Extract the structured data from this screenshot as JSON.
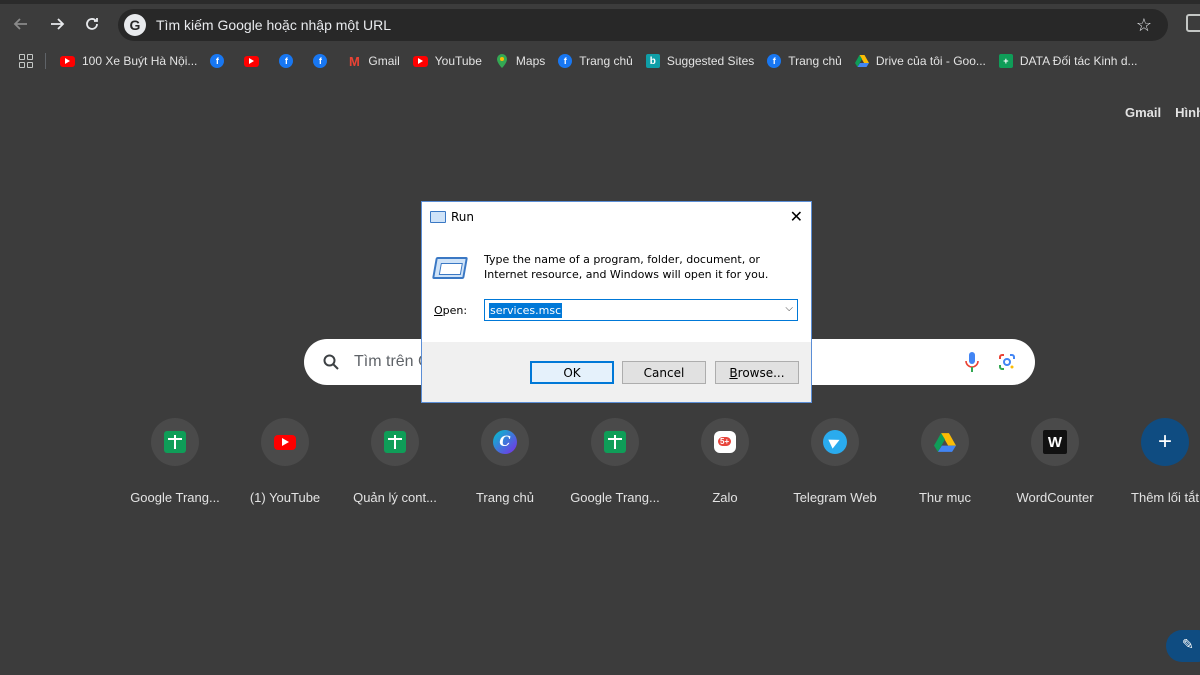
{
  "browser": {
    "omnibox_text": "Tìm kiếm Google hoặc nhập một URL",
    "omnibox_logo": "G"
  },
  "bookmarks": [
    {
      "label": "100 Xe Buýt Hà Nội...",
      "icon": "youtube-icon"
    },
    {
      "label": "",
      "icon": "facebook-icon"
    },
    {
      "label": "",
      "icon": "youtube-icon"
    },
    {
      "label": "",
      "icon": "facebook-icon"
    },
    {
      "label": "",
      "icon": "facebook-icon"
    },
    {
      "label": "Gmail",
      "icon": "gmail-icon"
    },
    {
      "label": "YouTube",
      "icon": "youtube-icon"
    },
    {
      "label": "Maps",
      "icon": "maps-icon"
    },
    {
      "label": "Trang chủ",
      "icon": "facebook-icon"
    },
    {
      "label": "Suggested Sites",
      "icon": "bing-icon"
    },
    {
      "label": "Trang chủ",
      "icon": "facebook-icon"
    },
    {
      "label": "Drive của tôi - Goo...",
      "icon": "drive-icon"
    },
    {
      "label": "DATA Đối tác Kinh d...",
      "icon": "sheets-icon"
    }
  ],
  "top_links": {
    "gmail": "Gmail",
    "images": "Hình"
  },
  "search": {
    "placeholder": "Tìm trên G"
  },
  "shortcuts": [
    {
      "label": "Google Trang...",
      "icon": "sheets-icon"
    },
    {
      "label": "(1) YouTube",
      "icon": "youtube-icon"
    },
    {
      "label": "Quản lý cont...",
      "icon": "sheets-icon"
    },
    {
      "label": "Trang chủ",
      "icon": "canva-icon"
    },
    {
      "label": "Google Trang...",
      "icon": "sheets-icon"
    },
    {
      "label": "Zalo",
      "icon": "zalo-icon"
    },
    {
      "label": "Telegram Web",
      "icon": "telegram-icon"
    },
    {
      "label": "Thư mục",
      "icon": "drive-icon"
    },
    {
      "label": "WordCounter",
      "icon": "wordcounter-icon"
    },
    {
      "label": "Thêm lối tắt",
      "icon": "plus-icon"
    }
  ],
  "run_dialog": {
    "title": "Run",
    "description": "Type the name of a program, folder, document, or Internet resource, and Windows will open it for you.",
    "open_label_prefix": "O",
    "open_label_rest": "pen:",
    "input_value": "services.msc",
    "ok": "OK",
    "cancel": "Cancel",
    "browse_prefix": "B",
    "browse_rest": "rowse..."
  },
  "colors": {
    "page_bg": "#3c3c3c",
    "accent": "#0078d7",
    "add_shortcut": "#0f4c81"
  }
}
